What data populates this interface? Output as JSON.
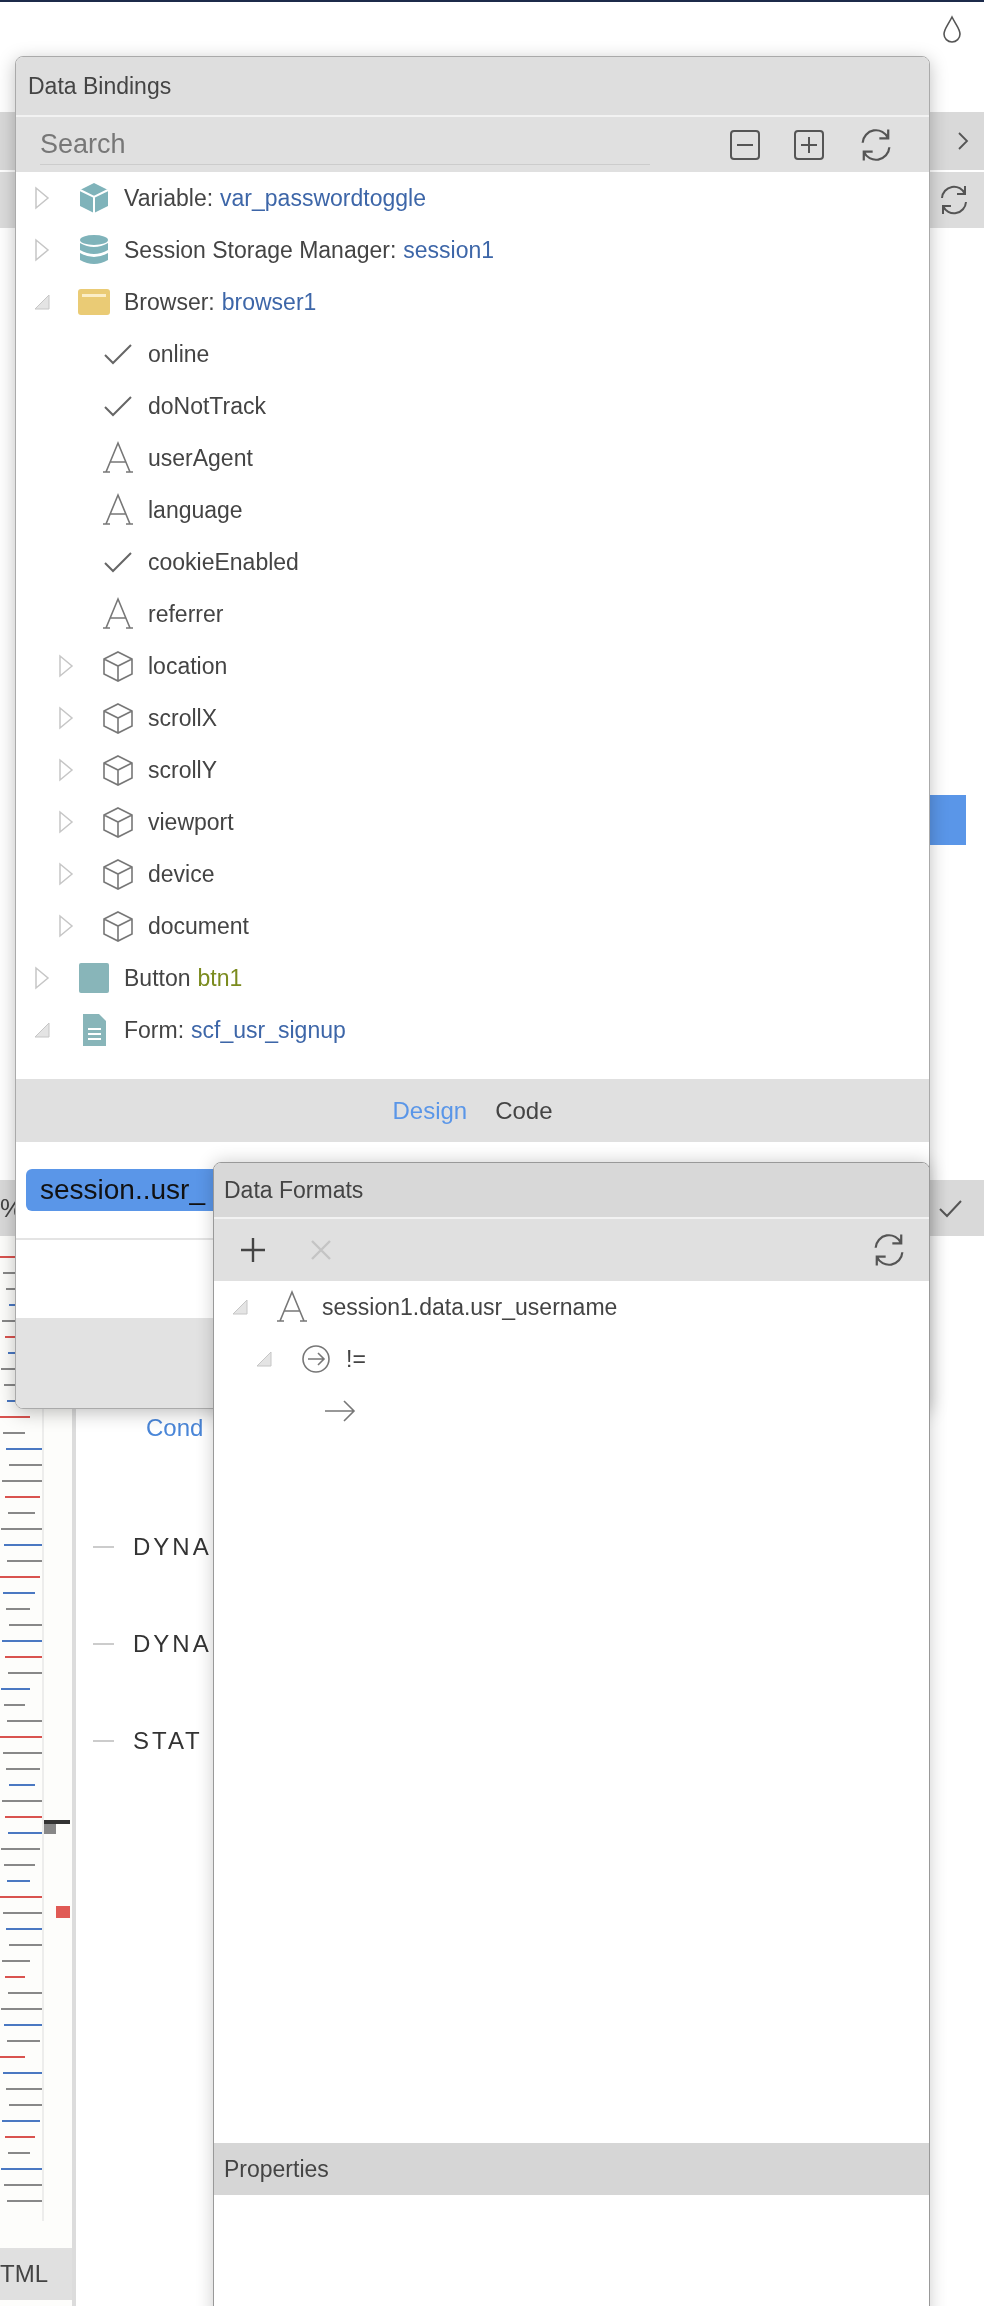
{
  "background": {
    "percent": "%",
    "link": "Cond",
    "sections": [
      "DYNA",
      "DYNA",
      "STAT"
    ],
    "bottom_tab": "TML"
  },
  "data_bindings": {
    "title": "Data Bindings",
    "search": {
      "placeholder": "Search"
    },
    "tree": [
      {
        "kind": "variable",
        "label": "Variable:",
        "value": "var_passwordtoggle",
        "color": "#3d66a8",
        "expanded": false
      },
      {
        "kind": "storage",
        "label": "Session Storage Manager:",
        "value": "session1",
        "color": "#3d66a8",
        "expanded": false
      },
      {
        "kind": "browser",
        "label": "Browser:",
        "value": "browser1",
        "color": "#3d66a8",
        "expanded": true,
        "children": [
          {
            "kind": "boolean",
            "label": "online"
          },
          {
            "kind": "boolean",
            "label": "doNotTrack"
          },
          {
            "kind": "string",
            "label": "userAgent"
          },
          {
            "kind": "string",
            "label": "language"
          },
          {
            "kind": "boolean",
            "label": "cookieEnabled"
          },
          {
            "kind": "string",
            "label": "referrer"
          },
          {
            "kind": "object",
            "label": "location",
            "expanded": false
          },
          {
            "kind": "object",
            "label": "scrollX",
            "expanded": false
          },
          {
            "kind": "object",
            "label": "scrollY",
            "expanded": false
          },
          {
            "kind": "object",
            "label": "viewport",
            "expanded": false
          },
          {
            "kind": "object",
            "label": "device",
            "expanded": false
          },
          {
            "kind": "object",
            "label": "document",
            "expanded": false
          }
        ]
      },
      {
        "kind": "button",
        "label": "Button",
        "value": "btn1",
        "color": "#7b8b1e",
        "expanded": false
      },
      {
        "kind": "form",
        "label": "Form:",
        "value": "scf_usr_signup",
        "color": "#3d66a8",
        "expanded": true
      }
    ],
    "tabs": [
      {
        "label": "Design",
        "selected": true
      },
      {
        "label": "Code",
        "selected": false
      }
    ],
    "binding_chip": "session..usr_"
  },
  "data_formats": {
    "title": "Data Formats",
    "toolbar": [
      {
        "kind": "add",
        "disabled": false
      },
      {
        "kind": "remove",
        "disabled": true
      },
      {
        "kind": "refresh",
        "disabled": false
      }
    ],
    "tree": [
      {
        "kind": "string",
        "label": "session1.data.usr_username",
        "expanded": true,
        "children": [
          {
            "kind": "operator",
            "label": "!=",
            "expanded": true,
            "children": [
              {
                "kind": "arrow"
              }
            ]
          }
        ]
      }
    ],
    "properties_title": "Properties"
  }
}
